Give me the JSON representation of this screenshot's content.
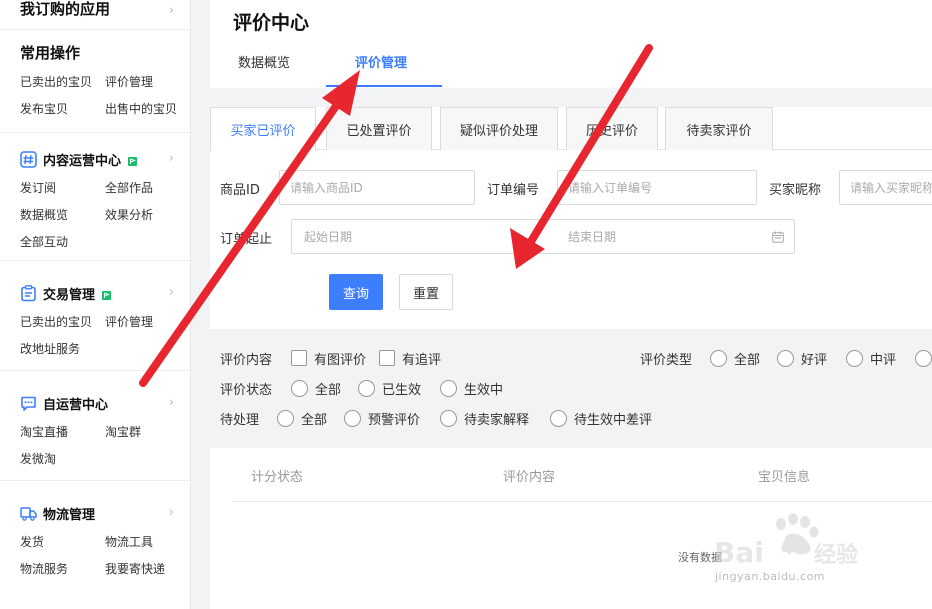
{
  "sidebar": {
    "top_title": "我订购的应用",
    "common": {
      "title": "常用操作",
      "links": [
        "已卖出的宝贝",
        "评价管理",
        "发布宝贝",
        "出售中的宝贝"
      ]
    },
    "sections": [
      {
        "title": "内容运营中心",
        "icon": "hash-icon",
        "links": [
          "发订阅",
          "全部作品",
          "数据概览",
          "效果分析",
          "全部互动"
        ]
      },
      {
        "title": "交易管理",
        "icon": "clipboard-icon",
        "links": [
          "已卖出的宝贝",
          "评价管理",
          "改地址服务"
        ]
      },
      {
        "title": "自运营中心",
        "icon": "chat-bubble-icon",
        "links": [
          "淘宝直播",
          "淘宝群",
          "发微淘"
        ]
      },
      {
        "title": "物流管理",
        "icon": "truck-icon",
        "links": [
          "发货",
          "物流工具",
          "物流服务",
          "我要寄快递"
        ]
      }
    ]
  },
  "header": {
    "title": "评价中心",
    "tabs": [
      "数据概览",
      "评价管理"
    ],
    "active_tab": "评价管理"
  },
  "subtabs": [
    "买家已评价",
    "已处置评价",
    "疑似评价处理",
    "历史评价",
    "待卖家评价"
  ],
  "search": {
    "product_id_label": "商品ID",
    "product_id_placeholder": "请输入商品ID",
    "order_no_label": "订单编号",
    "order_no_placeholder": "请输入订单编号",
    "buyer_nick_label": "买家昵称",
    "buyer_nick_placeholder": "请输入买家昵称",
    "date_label": "订单起止",
    "start_placeholder": "起始日期",
    "end_placeholder": "结束日期",
    "query_button": "查询",
    "reset_button": "重置"
  },
  "filters": {
    "content": {
      "label": "评价内容",
      "options": [
        "有图评价",
        "有追评"
      ]
    },
    "type": {
      "label": "评价类型",
      "options": [
        "全部",
        "好评",
        "中评"
      ]
    },
    "status": {
      "label": "评价状态",
      "options": [
        "全部",
        "已生效",
        "生效中"
      ]
    },
    "pending": {
      "label": "待处理",
      "options": [
        "全部",
        "预警评价",
        "待卖家解释",
        "待生效中差评"
      ]
    }
  },
  "table": {
    "columns": [
      "计分状态",
      "评价内容",
      "宝贝信息"
    ],
    "empty_text": "没有数据"
  },
  "watermark": {
    "brand": "Baidu经验",
    "url": "jingyan.baidu.com"
  },
  "colors": {
    "accent": "#3d7eff",
    "annotation_arrow": "#e8262f"
  }
}
